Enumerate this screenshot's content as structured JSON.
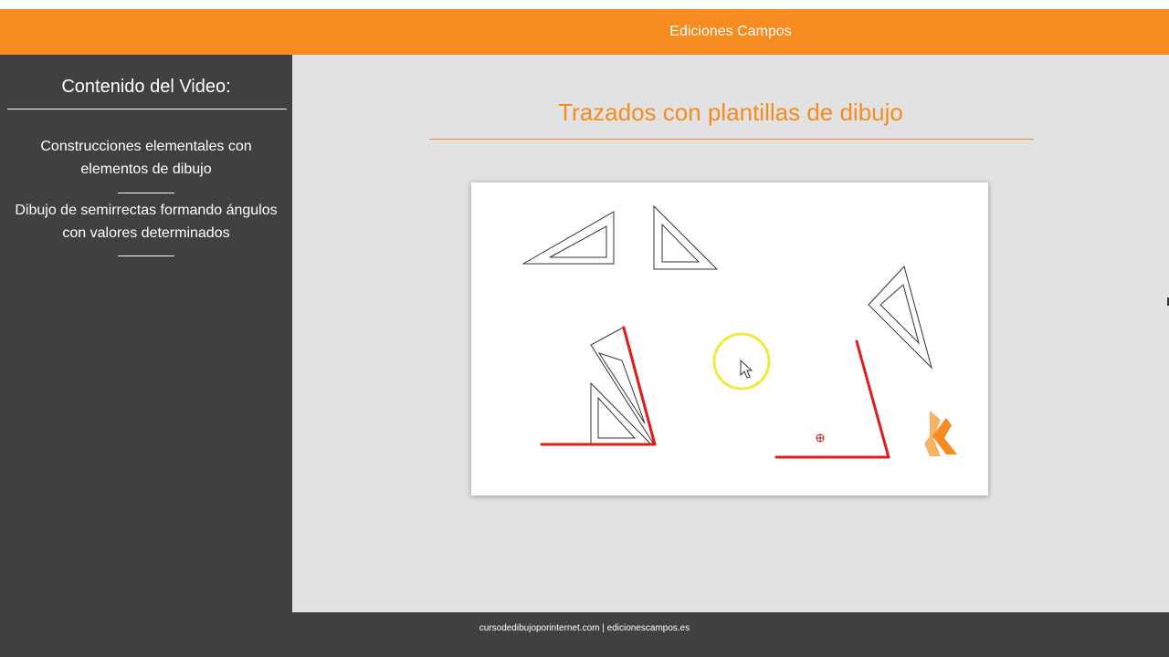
{
  "header": {
    "brand": "Ediciones Campos"
  },
  "sidebar": {
    "heading": "Contenido del Video:",
    "items": [
      {
        "line1": "Construcciones elementales con",
        "line2": "elementos de dibujo"
      },
      {
        "line1": "Dibujo de semirrectas formando ángulos",
        "line2": "con valores determinados"
      }
    ]
  },
  "main": {
    "title": "Trazados con plantillas de dibujo",
    "drawing": {
      "stroke_color": "#333333",
      "red_line_color": "#e31b1b",
      "highlight_color": "#f0ec3c",
      "logo_colors": [
        "#f68b1f",
        "#f6b266"
      ]
    }
  },
  "footer": {
    "text": "cursodedibujoporinternet.com | edicionescampos.es"
  },
  "colors": {
    "accent": "#f68b1f",
    "sidebar_bg": "#404040",
    "main_bg": "#e2e2e2"
  }
}
